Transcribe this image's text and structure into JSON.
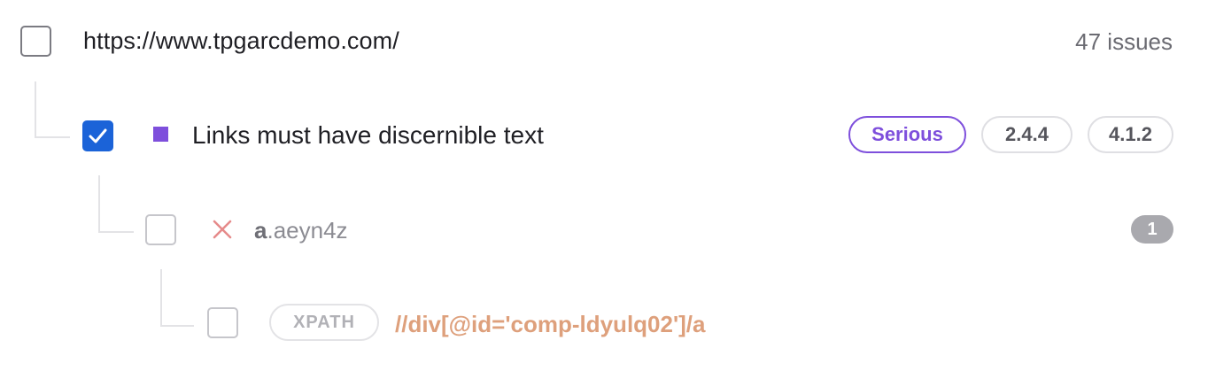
{
  "page": {
    "url": "https://www.tpgarcdemo.com/",
    "issue_count": "47 issues"
  },
  "rule": {
    "title": "Links must have discernible text",
    "severity": "Serious",
    "tags": [
      "2.4.4",
      "4.1.2"
    ],
    "marker_color": "#7e4fdc",
    "checked": true
  },
  "node": {
    "element": "a",
    "selector_class": ".aeyn4z",
    "count": "1",
    "status_icon": "close-icon"
  },
  "locator": {
    "type": "XPATH",
    "value": "//div[@id='comp-ldyulq02']/a"
  },
  "colors": {
    "accent_blue": "#1b63d8",
    "severity_purple": "#7e4fdc",
    "error_red": "#e58a8a",
    "xpath_orange": "#dea07c"
  }
}
